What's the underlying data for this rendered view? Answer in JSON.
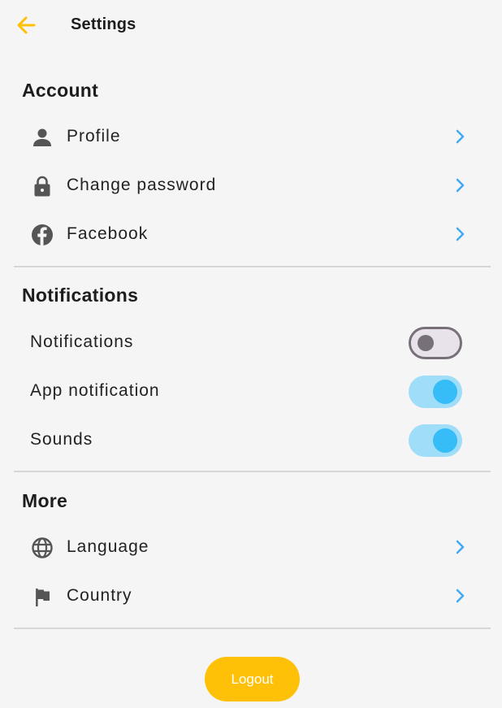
{
  "header": {
    "title": "Settings"
  },
  "sections": {
    "account": {
      "title": "Account",
      "items": [
        {
          "label": "Profile",
          "icon": "person-icon"
        },
        {
          "label": "Change password",
          "icon": "lock-icon"
        },
        {
          "label": "Facebook",
          "icon": "facebook-icon"
        }
      ]
    },
    "notifications": {
      "title": "Notifications",
      "toggles": [
        {
          "label": "Notifications",
          "enabled": false
        },
        {
          "label": "App notification",
          "enabled": true
        },
        {
          "label": "Sounds",
          "enabled": true
        }
      ]
    },
    "more": {
      "title": "More",
      "items": [
        {
          "label": "Language",
          "icon": "globe-icon"
        },
        {
          "label": "Country",
          "icon": "flag-icon"
        }
      ]
    }
  },
  "logout": {
    "label": "Logout"
  },
  "colors": {
    "accent": "#ffc107",
    "chevron": "#3fa9f5",
    "toggle_on_track": "#9fddf8",
    "toggle_on_knob": "#36bcf6",
    "toggle_off_track": "#e8e2ea",
    "toggle_off_knob": "#787079",
    "background": "#f5f5f5"
  }
}
